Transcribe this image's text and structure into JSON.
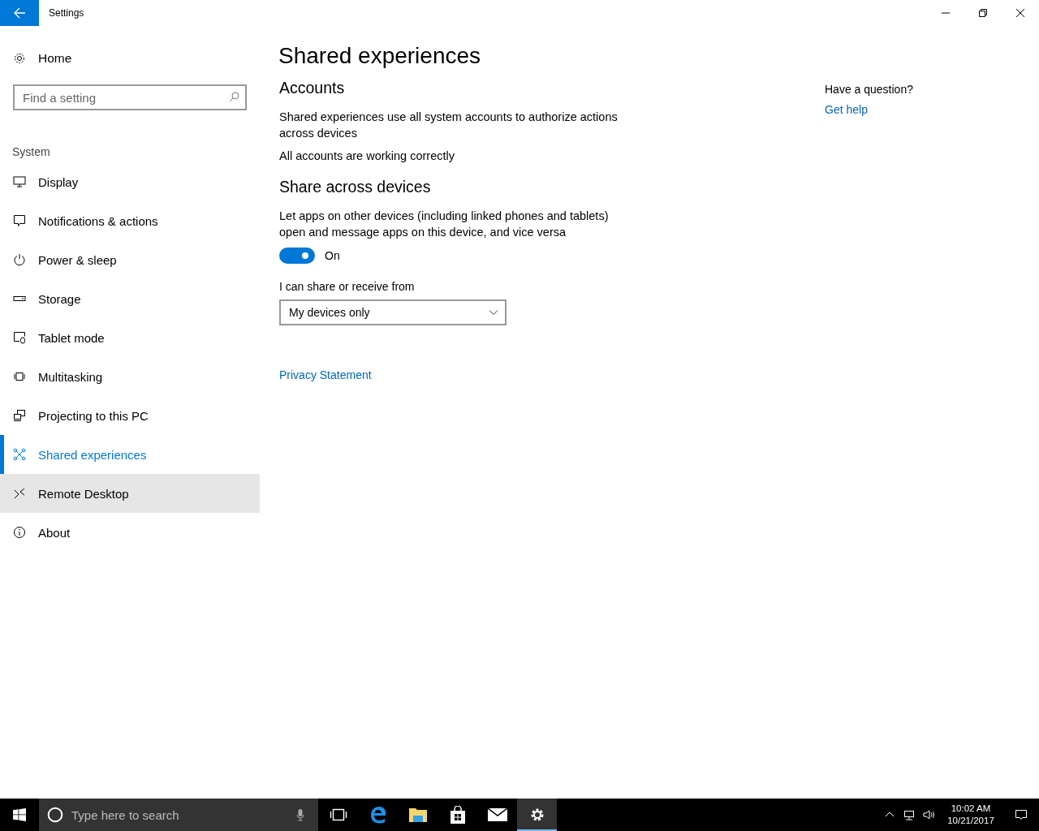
{
  "window": {
    "title": "Settings"
  },
  "sidebar": {
    "home": "Home",
    "search": {
      "placeholder": "Find a setting"
    },
    "section": "System",
    "items": [
      {
        "label": "Display",
        "kind": "display",
        "selected": false,
        "hovered": false
      },
      {
        "label": "Notifications & actions",
        "kind": "notifications",
        "selected": false,
        "hovered": false
      },
      {
        "label": "Power & sleep",
        "kind": "power",
        "selected": false,
        "hovered": false
      },
      {
        "label": "Storage",
        "kind": "storage",
        "selected": false,
        "hovered": false
      },
      {
        "label": "Tablet mode",
        "kind": "tablet",
        "selected": false,
        "hovered": false
      },
      {
        "label": "Multitasking",
        "kind": "multitasking",
        "selected": false,
        "hovered": false
      },
      {
        "label": "Projecting to this PC",
        "kind": "projecting",
        "selected": false,
        "hovered": false
      },
      {
        "label": "Shared experiences",
        "kind": "shared",
        "selected": true,
        "hovered": false
      },
      {
        "label": "Remote Desktop",
        "kind": "remote",
        "selected": false,
        "hovered": true
      },
      {
        "label": "About",
        "kind": "about",
        "selected": false,
        "hovered": false
      }
    ]
  },
  "content": {
    "title": "Shared experiences",
    "accounts": {
      "heading": "Accounts",
      "description": "Shared experiences use all system accounts to authorize actions across devices",
      "status": "All accounts are working correctly"
    },
    "share": {
      "heading": "Share across devices",
      "description": "Let apps on other devices (including linked phones and tablets) open and message apps on this device, and vice versa",
      "toggle": {
        "on": true,
        "label": "On"
      },
      "dropdown_label": "I can share or receive from",
      "dropdown": {
        "value": "My devices only"
      }
    },
    "privacy_link": "Privacy Statement"
  },
  "help": {
    "question": "Have a question?",
    "link": "Get help"
  },
  "taskbar": {
    "search": {
      "placeholder": "Type here to search"
    },
    "apps": [
      {
        "kind": "taskview",
        "active": false
      },
      {
        "kind": "browser",
        "active": false
      },
      {
        "kind": "folder",
        "active": false
      },
      {
        "kind": "store",
        "active": false
      },
      {
        "kind": "mail",
        "active": false
      },
      {
        "kind": "settings",
        "active": true
      }
    ],
    "clock": {
      "time": "10:02 AM",
      "date": "10/21/2017"
    }
  }
}
